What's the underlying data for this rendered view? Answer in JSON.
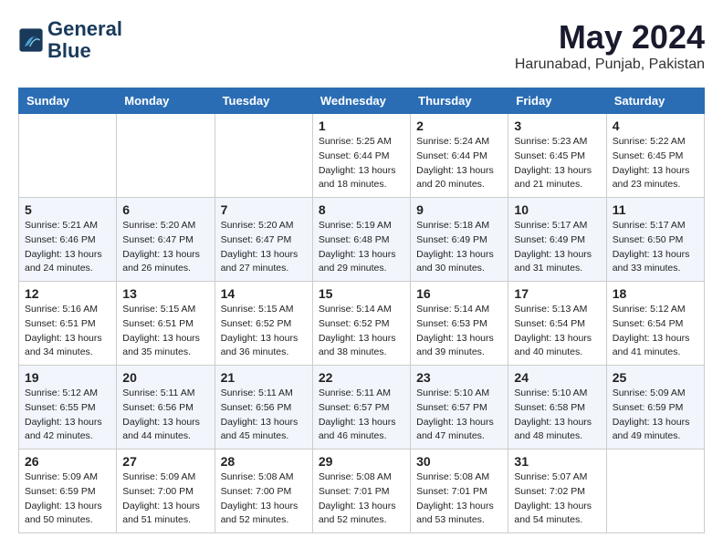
{
  "header": {
    "logo_line1": "General",
    "logo_line2": "Blue",
    "month": "May 2024",
    "location": "Harunabad, Punjab, Pakistan"
  },
  "days_of_week": [
    "Sunday",
    "Monday",
    "Tuesday",
    "Wednesday",
    "Thursday",
    "Friday",
    "Saturday"
  ],
  "weeks": [
    [
      {
        "day": "",
        "info": ""
      },
      {
        "day": "",
        "info": ""
      },
      {
        "day": "",
        "info": ""
      },
      {
        "day": "1",
        "info": "Sunrise: 5:25 AM\nSunset: 6:44 PM\nDaylight: 13 hours\nand 18 minutes."
      },
      {
        "day": "2",
        "info": "Sunrise: 5:24 AM\nSunset: 6:44 PM\nDaylight: 13 hours\nand 20 minutes."
      },
      {
        "day": "3",
        "info": "Sunrise: 5:23 AM\nSunset: 6:45 PM\nDaylight: 13 hours\nand 21 minutes."
      },
      {
        "day": "4",
        "info": "Sunrise: 5:22 AM\nSunset: 6:45 PM\nDaylight: 13 hours\nand 23 minutes."
      }
    ],
    [
      {
        "day": "5",
        "info": "Sunrise: 5:21 AM\nSunset: 6:46 PM\nDaylight: 13 hours\nand 24 minutes."
      },
      {
        "day": "6",
        "info": "Sunrise: 5:20 AM\nSunset: 6:47 PM\nDaylight: 13 hours\nand 26 minutes."
      },
      {
        "day": "7",
        "info": "Sunrise: 5:20 AM\nSunset: 6:47 PM\nDaylight: 13 hours\nand 27 minutes."
      },
      {
        "day": "8",
        "info": "Sunrise: 5:19 AM\nSunset: 6:48 PM\nDaylight: 13 hours\nand 29 minutes."
      },
      {
        "day": "9",
        "info": "Sunrise: 5:18 AM\nSunset: 6:49 PM\nDaylight: 13 hours\nand 30 minutes."
      },
      {
        "day": "10",
        "info": "Sunrise: 5:17 AM\nSunset: 6:49 PM\nDaylight: 13 hours\nand 31 minutes."
      },
      {
        "day": "11",
        "info": "Sunrise: 5:17 AM\nSunset: 6:50 PM\nDaylight: 13 hours\nand 33 minutes."
      }
    ],
    [
      {
        "day": "12",
        "info": "Sunrise: 5:16 AM\nSunset: 6:51 PM\nDaylight: 13 hours\nand 34 minutes."
      },
      {
        "day": "13",
        "info": "Sunrise: 5:15 AM\nSunset: 6:51 PM\nDaylight: 13 hours\nand 35 minutes."
      },
      {
        "day": "14",
        "info": "Sunrise: 5:15 AM\nSunset: 6:52 PM\nDaylight: 13 hours\nand 36 minutes."
      },
      {
        "day": "15",
        "info": "Sunrise: 5:14 AM\nSunset: 6:52 PM\nDaylight: 13 hours\nand 38 minutes."
      },
      {
        "day": "16",
        "info": "Sunrise: 5:14 AM\nSunset: 6:53 PM\nDaylight: 13 hours\nand 39 minutes."
      },
      {
        "day": "17",
        "info": "Sunrise: 5:13 AM\nSunset: 6:54 PM\nDaylight: 13 hours\nand 40 minutes."
      },
      {
        "day": "18",
        "info": "Sunrise: 5:12 AM\nSunset: 6:54 PM\nDaylight: 13 hours\nand 41 minutes."
      }
    ],
    [
      {
        "day": "19",
        "info": "Sunrise: 5:12 AM\nSunset: 6:55 PM\nDaylight: 13 hours\nand 42 minutes."
      },
      {
        "day": "20",
        "info": "Sunrise: 5:11 AM\nSunset: 6:56 PM\nDaylight: 13 hours\nand 44 minutes."
      },
      {
        "day": "21",
        "info": "Sunrise: 5:11 AM\nSunset: 6:56 PM\nDaylight: 13 hours\nand 45 minutes."
      },
      {
        "day": "22",
        "info": "Sunrise: 5:11 AM\nSunset: 6:57 PM\nDaylight: 13 hours\nand 46 minutes."
      },
      {
        "day": "23",
        "info": "Sunrise: 5:10 AM\nSunset: 6:57 PM\nDaylight: 13 hours\nand 47 minutes."
      },
      {
        "day": "24",
        "info": "Sunrise: 5:10 AM\nSunset: 6:58 PM\nDaylight: 13 hours\nand 48 minutes."
      },
      {
        "day": "25",
        "info": "Sunrise: 5:09 AM\nSunset: 6:59 PM\nDaylight: 13 hours\nand 49 minutes."
      }
    ],
    [
      {
        "day": "26",
        "info": "Sunrise: 5:09 AM\nSunset: 6:59 PM\nDaylight: 13 hours\nand 50 minutes."
      },
      {
        "day": "27",
        "info": "Sunrise: 5:09 AM\nSunset: 7:00 PM\nDaylight: 13 hours\nand 51 minutes."
      },
      {
        "day": "28",
        "info": "Sunrise: 5:08 AM\nSunset: 7:00 PM\nDaylight: 13 hours\nand 52 minutes."
      },
      {
        "day": "29",
        "info": "Sunrise: 5:08 AM\nSunset: 7:01 PM\nDaylight: 13 hours\nand 52 minutes."
      },
      {
        "day": "30",
        "info": "Sunrise: 5:08 AM\nSunset: 7:01 PM\nDaylight: 13 hours\nand 53 minutes."
      },
      {
        "day": "31",
        "info": "Sunrise: 5:07 AM\nSunset: 7:02 PM\nDaylight: 13 hours\nand 54 minutes."
      },
      {
        "day": "",
        "info": ""
      }
    ]
  ]
}
